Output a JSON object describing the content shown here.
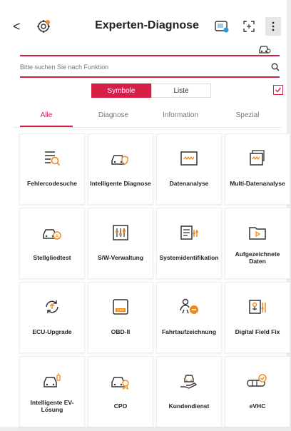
{
  "header": {
    "back_glyph": "<",
    "title": "Experten-Diagnose"
  },
  "search": {
    "placeholder": "Bitte suchen Sie nach Funktion"
  },
  "view_toggle": {
    "options": [
      "Symbole",
      "Liste"
    ],
    "selected": "Symbole"
  },
  "tabs": [
    "Alle",
    "Diagnose",
    "Information",
    "Spezial"
  ],
  "active_tab": "Alle",
  "tiles": [
    {
      "label": "Fehlercodesuche",
      "icon": "code-search-icon"
    },
    {
      "label": "Intelligente Diagnose",
      "icon": "car-shield-icon"
    },
    {
      "label": "Datenanalyse",
      "icon": "data-wave-icon"
    },
    {
      "label": "Multi-Datenanalyse",
      "icon": "multi-data-icon"
    },
    {
      "label": "Stellgliedtest",
      "icon": "car-actuator-icon"
    },
    {
      "label": "S/W-Verwaltung",
      "icon": "sliders-icon"
    },
    {
      "label": "Systemidentifikation",
      "icon": "system-id-icon"
    },
    {
      "label": "Aufgezeichnete Daten",
      "icon": "folder-play-icon"
    },
    {
      "label": "ECU-Upgrade",
      "icon": "upgrade-cycle-icon"
    },
    {
      "label": "OBD-II",
      "icon": "obd-icon"
    },
    {
      "label": "Fahrtaufzeichnung",
      "icon": "drive-record-icon"
    },
    {
      "label": "Digital Field Fix",
      "icon": "field-fix-icon"
    },
    {
      "label": "Intelligente EV-Lösung",
      "icon": "ev-battery-icon"
    },
    {
      "label": "CPO",
      "icon": "car-badge-icon"
    },
    {
      "label": "Kundendienst",
      "icon": "service-hand-icon"
    },
    {
      "label": "eVHC",
      "icon": "evhc-icon"
    }
  ],
  "colors": {
    "accent": "#d51f49",
    "icon_orange": "#f08a1c"
  }
}
